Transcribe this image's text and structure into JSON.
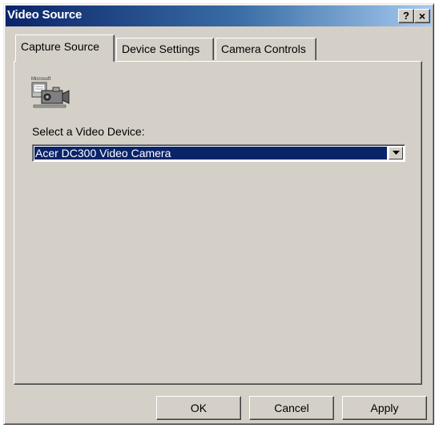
{
  "window": {
    "title": "Video Source",
    "help_glyph": "?",
    "close_glyph": "×"
  },
  "tabs": [
    {
      "label": "Capture Source",
      "active": true
    },
    {
      "label": "Device Settings",
      "active": false
    },
    {
      "label": "Camera Controls",
      "active": false
    }
  ],
  "capture_source": {
    "icon": "camera-device-icon",
    "icon_caption": "Microsoft",
    "select_label": "Select a Video Device:",
    "selected_device": "Acer DC300 Video Camera"
  },
  "buttons": {
    "ok": "OK",
    "cancel": "Cancel",
    "apply": "Apply"
  },
  "colors": {
    "face": "#d4d0c8",
    "titlebar_start": "#0a246a",
    "titlebar_end": "#a6caf0",
    "selection": "#0a246a"
  }
}
